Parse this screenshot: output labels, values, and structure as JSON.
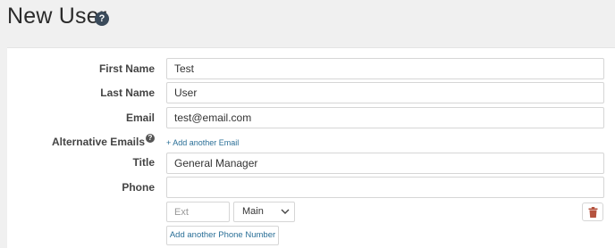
{
  "header": {
    "title": "New User",
    "help_icon_glyph": "?"
  },
  "form": {
    "first_name": {
      "label": "First Name",
      "value": "Test"
    },
    "last_name": {
      "label": "Last Name",
      "value": "User"
    },
    "email": {
      "label": "Email",
      "value": "test@email.com"
    },
    "alternative_emails": {
      "label": "Alternative Emails",
      "help_icon_glyph": "?",
      "add_link": "+ Add another Email"
    },
    "title": {
      "label": "Title",
      "value": "General Manager"
    },
    "phone": {
      "label": "Phone",
      "value": "",
      "ext_placeholder": "Ext",
      "type_selected": "Main",
      "delete_icon": "trash-icon",
      "add_button": "Add another Phone Number"
    }
  },
  "colors": {
    "link": "#2a6f97",
    "delete": "#b5533f",
    "help_badge": "#3a4a5a"
  }
}
